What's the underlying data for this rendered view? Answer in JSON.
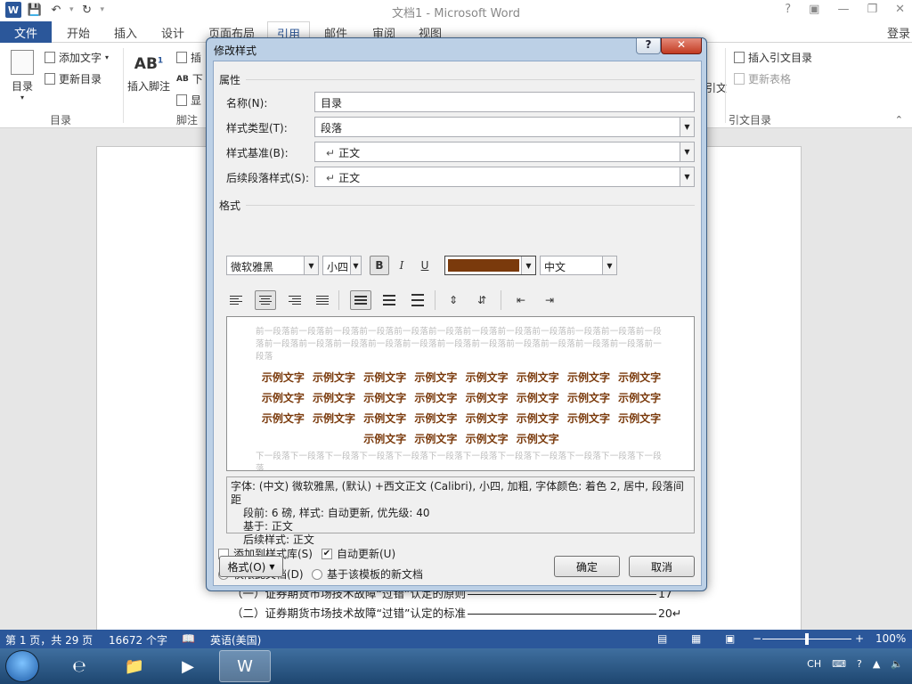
{
  "window": {
    "title": "文档1 - Microsoft Word",
    "login": "登录"
  },
  "qat": {
    "word_logo": "W"
  },
  "tabs": {
    "file": "文件",
    "home": "开始",
    "insert": "插入",
    "design": "设计",
    "layout": "页面布局",
    "references": "引用",
    "mailings": "邮件",
    "review": "审阅",
    "view": "视图"
  },
  "ribbon": {
    "toc": "目录",
    "add_text": "添加文字",
    "update_toc": "更新目录",
    "insert_footnote": "插入脚注",
    "ab_label": "AB",
    "ab_super": "1",
    "insert_cut": "插",
    "next_cut": "下",
    "show_cut": "显",
    "insert_toa": "插入引文目录",
    "update_table": "更新表格",
    "cite_cut": "引文",
    "group_toc": "目录",
    "group_footnote": "脚注",
    "group_toa": "引文目录"
  },
  "document": {
    "line1": "（一）证券期货市场技术故障“过错”认定的原则",
    "line1_page": "17",
    "line2": "（二）证券期货市场技术故障“过错”认定的标准",
    "line2_page": "20"
  },
  "status": {
    "page": "第 1 页，共 29 页",
    "words": "16672 个字",
    "lang": "英语(美国)",
    "zoom": "100%",
    "zoom_level": 0.5
  },
  "dialog": {
    "title": "修改样式",
    "help": "?",
    "section_properties": "属性",
    "name_label": "名称(N):",
    "name_value": "目录",
    "type_label": "样式类型(T):",
    "type_value": "段落",
    "based_label": "样式基准(B):",
    "based_value": "正文",
    "next_label": "后续段落样式(S):",
    "next_value": "正文",
    "section_format": "格式",
    "font": "微软雅黑",
    "size": "小四",
    "bold": "B",
    "italic": "I",
    "underline": "U",
    "font_color": "#7a3a0c",
    "script": "中文",
    "preview_prev": "前一段落前一段落前一段落前一段落前一段落前一段落前一段落前一段落前一段落前一段落前一段落前一段落前一段落前一段落前一段落前一段落前一段落前一段落前一段落前一段落前一段落前一段落前一段落前一段落",
    "preview_sample": "示例文字 示例文字 示例文字 示例文字 示例文字 示例文字 示例文字 示例文字 示例文字 示例文字 示例文字 示例文字 示例文字 示例文字 示例文字 示例文字 示例文字 示例文字 示例文字 示例文字 示例文字 示例文字 示例文字 示例文字 示例文字 示例文字 示例文字 示例文字",
    "preview_next": "下一段落下一段落下一段落下一段落下一段落下一段落下一段落下一段落下一段落下一段落下一段落下一段落",
    "desc_line1": "字体: (中文) 微软雅黑, (默认) +西文正文 (Calibri), 小四, 加粗, 字体颜色: 着色 2, 居中, 段落间距",
    "desc_line2": "段前: 6 磅, 样式: 自动更新, 优先级: 40",
    "desc_line3": "基于: 正文",
    "desc_line4": "后续样式: 正文",
    "add_to_gallery": "添加到样式库(S)",
    "add_to_gallery_checked": false,
    "auto_update": "自动更新(U)",
    "auto_update_checked": true,
    "only_this_doc": "仅限此文档(D)",
    "new_docs_template": "基于该模板的新文档",
    "format_button": "格式(O)",
    "ok": "确定",
    "cancel": "取消"
  }
}
